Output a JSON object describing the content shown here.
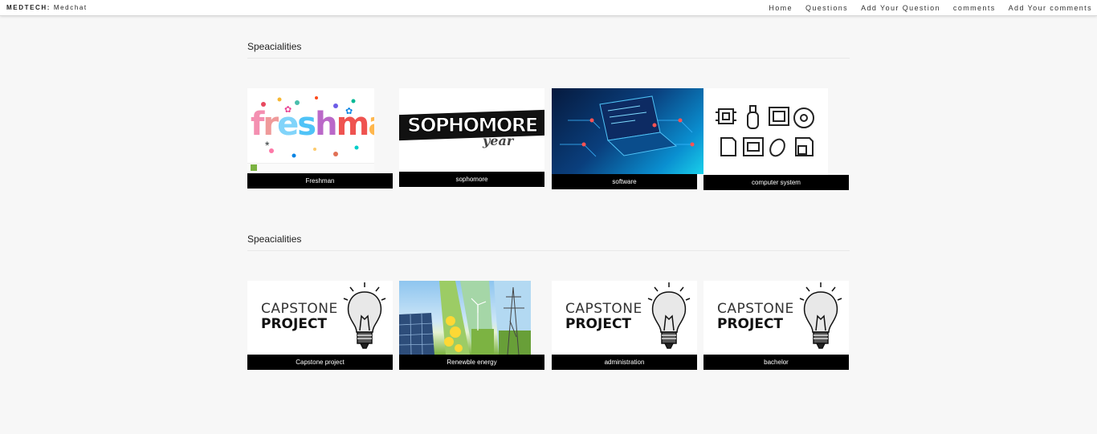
{
  "brand": {
    "bold": "MEDTECH:",
    "name": "Medchat"
  },
  "nav": [
    "Home",
    "Questions",
    "Add Your Question",
    "comments",
    "Add Your comments"
  ],
  "sections": [
    {
      "title": "Speacialities",
      "cards": [
        {
          "label": "Freshman",
          "image_text": "freshman"
        },
        {
          "label": "sophomore",
          "image_text": "SOPHOMORE",
          "image_subtext": "year"
        },
        {
          "label": "software"
        },
        {
          "label": "computer system"
        }
      ]
    },
    {
      "title": "Speacialities",
      "cards": [
        {
          "label": "Capstone project",
          "image_text": "CAPSTONE",
          "image_subtext": "PROJECT"
        },
        {
          "label": "Renewble energy"
        },
        {
          "label": "administration",
          "image_text": "CAPSTONE",
          "image_subtext": "PROJECT"
        },
        {
          "label": "bachelor",
          "image_text": "CAPSTONE",
          "image_subtext": "PROJECT"
        }
      ]
    }
  ],
  "colors": {
    "page_bg": "#f7f7f7",
    "caption_bg": "#000000",
    "caption_text": "#ffffff"
  }
}
